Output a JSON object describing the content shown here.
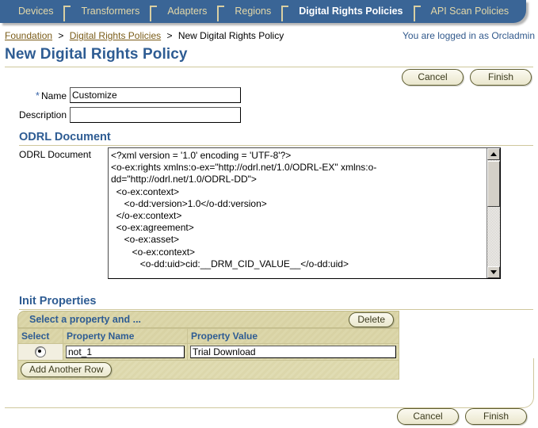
{
  "tabs": [
    {
      "label": "Devices",
      "active": false
    },
    {
      "label": "Transformers",
      "active": false
    },
    {
      "label": "Adapters",
      "active": false
    },
    {
      "label": "Regions",
      "active": false
    },
    {
      "label": "Digital Rights Policies",
      "active": true
    },
    {
      "label": "API Scan Policies",
      "active": false
    }
  ],
  "breadcrumb": {
    "items": [
      "Foundation",
      "Digital Rights Policies"
    ],
    "current": "New Digital Rights Policy",
    "separator": ">"
  },
  "login_status": "You are logged in as Orcladmin",
  "page_title": "New Digital Rights Policy",
  "buttons": {
    "cancel": "Cancel",
    "finish": "Finish",
    "delete": "Delete",
    "add_another_row": "Add Another Row"
  },
  "form": {
    "name_label": "Name",
    "name_required_marker": "*",
    "name_value": "Customize",
    "name_placeholder": "",
    "description_label": "Description",
    "description_value": "",
    "description_placeholder": ""
  },
  "odrl_section": {
    "heading": "ODRL Document",
    "field_label": "ODRL Document",
    "document_text": "<?xml version = '1.0' encoding = 'UTF-8'?>\n<o-ex:rights xmlns:o-ex=\"http://odrl.net/1.0/ODRL-EX\" xmlns:o-dd=\"http://odrl.net/1.0/ODRL-DD\">\n  <o-ex:context>\n     <o-dd:version>1.0</o-dd:version>\n  </o-ex:context>\n  <o-ex:agreement>\n     <o-ex:asset>\n        <o-ex:context>\n           <o-dd:uid>cid:__DRM_CID_VALUE__</o-dd:uid>"
  },
  "init_properties": {
    "heading": "Init Properties",
    "bar_title": "Select a property and ...",
    "columns": [
      "Select",
      "Property Name",
      "Property Value"
    ],
    "rows": [
      {
        "selected": true,
        "property_name": "not_1",
        "property_value": "Trial Download"
      }
    ]
  },
  "colors": {
    "tab_bar_blue": "#3a6596",
    "tab_inactive_text": "#e4d8a8",
    "tab_active_text": "#ffffff",
    "heading_blue": "#2e5c93",
    "link_brown": "#7a5c18",
    "rule_tan": "#cfc79c",
    "table_khaki": "#dcd7ab",
    "button_cream": "#eae7cd"
  }
}
